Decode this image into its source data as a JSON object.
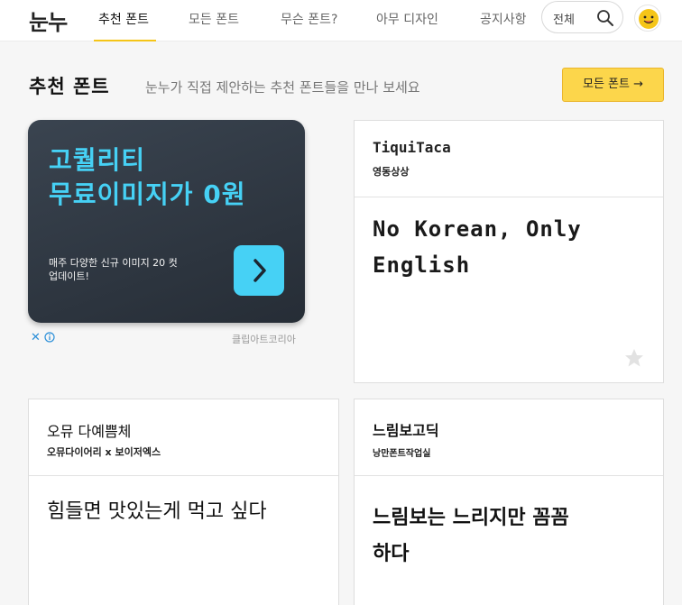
{
  "header": {
    "logo": "눈누",
    "nav": [
      "추천 폰트",
      "모든 폰트",
      "무슨 폰트?",
      "아무 디자인",
      "공지사항"
    ],
    "search": {
      "value": "전체",
      "icon": "search-icon"
    },
    "avatar_icon": "smile-avatar-icon",
    "accent_color": "#f5c518"
  },
  "section": {
    "title": "추천 폰트",
    "subtitle": "눈누가 직접 제안하는 추천 폰트들을 만나 보세요",
    "all_fonts_button": "모든 폰트 →"
  },
  "ad": {
    "headline_line1": "고퀄리티",
    "headline_line2": "무료이미지가 0원",
    "body_line1": "매주 다양한 신규 이미지 20 컷",
    "body_line2": "업데이트!",
    "close": "✕",
    "info_icon": "info-icon",
    "sponsor": "클립아트코리아",
    "headline_color": "#46d1f5"
  },
  "cards": [
    {
      "name": "TiquiTaca",
      "author": "영동상상",
      "sample": "No Korean, Only\nEnglish",
      "star_icon": "star-icon"
    },
    {
      "name": "오뮤 다예쁨체",
      "author": "오뮤다이어리 x 보이저엑스",
      "sample": "힘들면 맛있는게 먹고 싶다"
    },
    {
      "name": "느림보고딕",
      "author": "낭만폰트작업실",
      "sample": "느림보는 느리지만 꼼꼼\n하다"
    }
  ]
}
